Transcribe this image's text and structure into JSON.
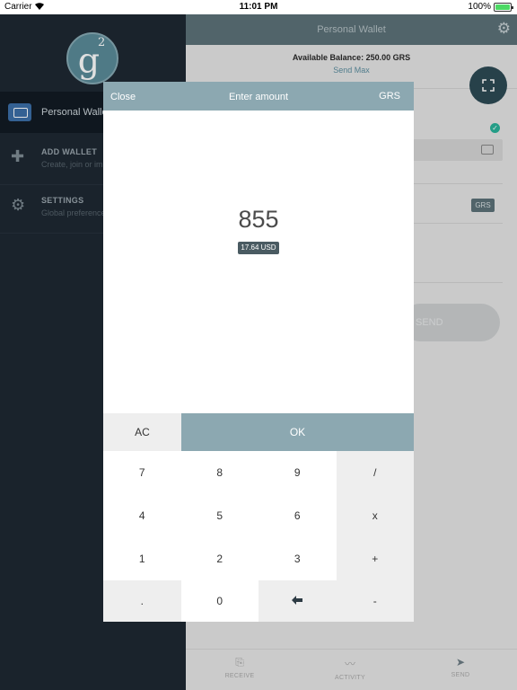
{
  "status_bar": {
    "carrier": "Carrier",
    "time": "11:01 PM",
    "battery": "100%"
  },
  "sidebar": {
    "logo_letter": "g",
    "logo_sup": "2",
    "items": [
      {
        "label": "Personal Wallet"
      },
      {
        "title": "ADD WALLET",
        "subtitle": "Create, join or import"
      },
      {
        "title": "SETTINGS",
        "subtitle": "Global preferences"
      }
    ]
  },
  "main": {
    "header_title": "Personal Wallet",
    "balance": "Available Balance: 250.00 GRS",
    "send_max": "Send Max",
    "currency_tag": "GRS",
    "send_button": "SEND",
    "tabs": [
      {
        "label": "RECEIVE",
        "icon": "receive-icon"
      },
      {
        "label": "ACTIVITY",
        "icon": "activity-icon"
      },
      {
        "label": "SEND",
        "icon": "send-icon"
      }
    ]
  },
  "modal": {
    "close": "Close",
    "title": "Enter amount",
    "unit": "GRS",
    "amount": "855",
    "fiat": "17.64 USD",
    "ac": "AC",
    "ok": "OK",
    "keys": [
      "7",
      "8",
      "9",
      "/",
      "4",
      "5",
      "6",
      "x",
      "1",
      "2",
      "3",
      "+",
      ".",
      "0",
      "←",
      "-"
    ]
  },
  "colors": {
    "accent": "#8ca8b1",
    "sidebar_bg": "#1e2833",
    "header_bg": "#5d7279"
  }
}
